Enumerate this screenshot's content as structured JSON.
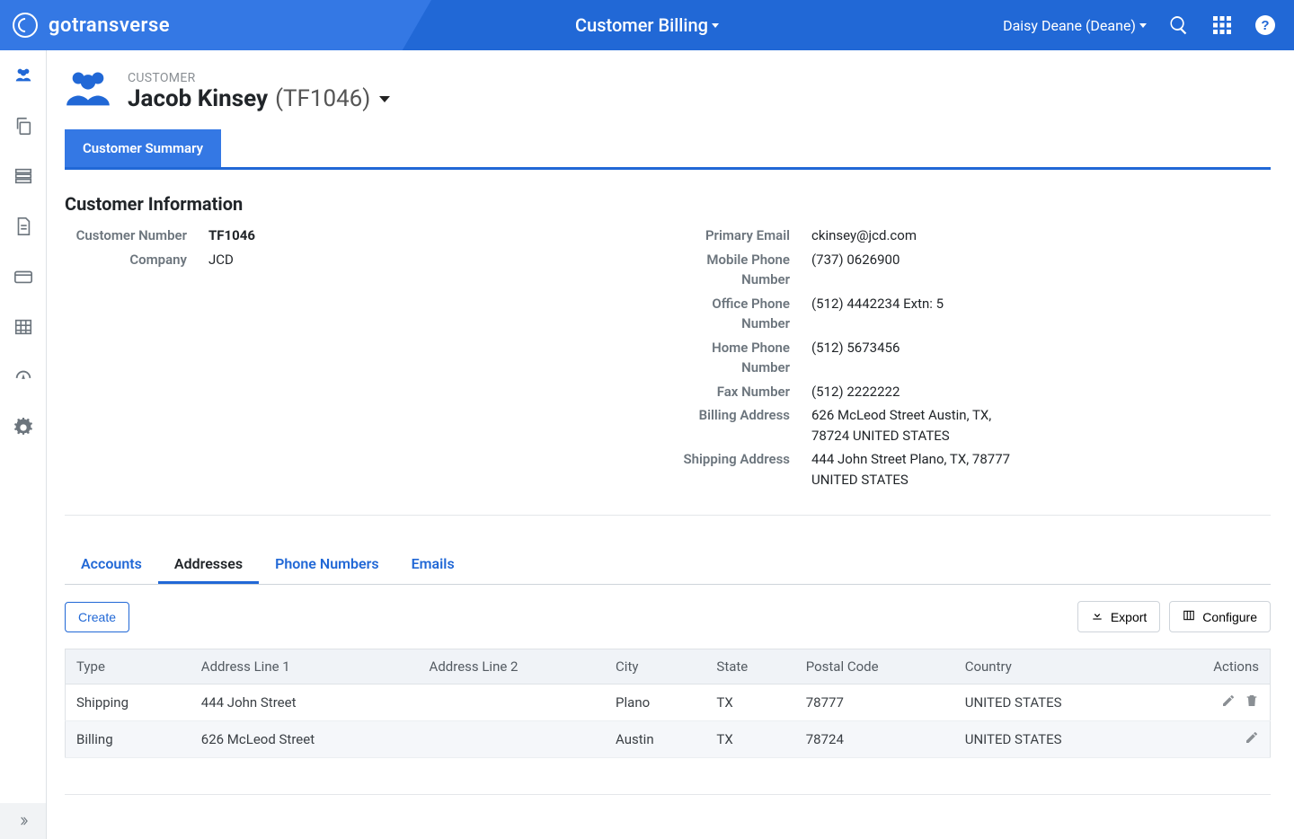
{
  "header": {
    "brand": "gotransverse",
    "title": "Customer Billing",
    "user": "Daisy Deane (Deane)"
  },
  "customer": {
    "label": "CUSTOMER",
    "name": "Jacob Kinsey",
    "id": "(TF1046)"
  },
  "primaryTab": "Customer Summary",
  "sectionTitle": "Customer Information",
  "infoLeft": [
    {
      "label": "Customer Number",
      "value": "TF1046",
      "bold": true
    },
    {
      "label": "Company",
      "value": "JCD"
    }
  ],
  "infoRight": [
    {
      "label": "Primary Email",
      "value": "ckinsey@jcd.com"
    },
    {
      "label": "Mobile Phone Number",
      "value": "(737) 0626900"
    },
    {
      "label": "Office Phone Number",
      "value": "(512) 4442234 Extn: 5"
    },
    {
      "label": "Home Phone Number",
      "value": "(512) 5673456"
    },
    {
      "label": "Fax Number",
      "value": "(512) 2222222"
    },
    {
      "label": "Billing Address",
      "value": "626 McLeod Street Austin, TX, 78724 UNITED STATES"
    },
    {
      "label": "Shipping Address",
      "value": "444 John Street Plano, TX, 78777 UNITED STATES"
    }
  ],
  "subtabs": [
    "Accounts",
    "Addresses",
    "Phone Numbers",
    "Emails"
  ],
  "activeSubtab": "Addresses",
  "buttons": {
    "create": "Create",
    "export": "Export",
    "configure": "Configure"
  },
  "tableHeaders": [
    "Type",
    "Address Line 1",
    "Address Line 2",
    "City",
    "State",
    "Postal Code",
    "Country",
    "Actions"
  ],
  "tableRows": [
    {
      "type": "Shipping",
      "line1": "444 John Street",
      "line2": "",
      "city": "Plano",
      "state": "TX",
      "postal": "78777",
      "country": "UNITED STATES",
      "canDelete": true
    },
    {
      "type": "Billing",
      "line1": "626 McLeod Street",
      "line2": "",
      "city": "Austin",
      "state": "TX",
      "postal": "78724",
      "country": "UNITED STATES",
      "canDelete": false
    }
  ]
}
